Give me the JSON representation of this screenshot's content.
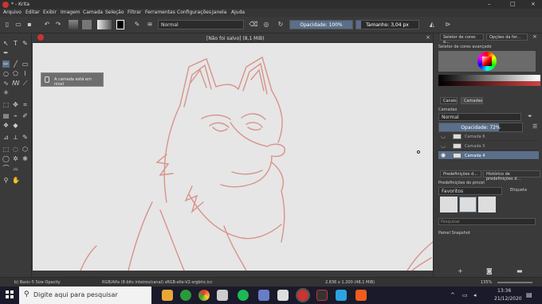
{
  "window": {
    "title": "* - Krita",
    "controls": [
      "–",
      "□",
      "×"
    ]
  },
  "menu": [
    "Arquivo",
    "Editar",
    "Exibir",
    "Imagem",
    "Camada",
    "Seleção",
    "Filtrar",
    "Ferramentas",
    "Configurações",
    "Janela",
    "Ajuda"
  ],
  "toolbar": {
    "blend_mode": "Normal",
    "opacity_label": "Opacidade: 100%",
    "opacity_value": 1.0,
    "size_label": "Tamanho: 3,04 px",
    "size_value": 0.08
  },
  "canvas": {
    "doc_title": "[Não foi salvo]  (8,1 MiB)",
    "tooltip": "A camada está em nível"
  },
  "docker": {
    "tabs": [
      "Seletor de cores a...",
      "Opções da fer..."
    ],
    "color_selector_title": "Seletor de cores avançado",
    "panel_tabs": [
      "Canais",
      "Camadas"
    ],
    "layers_title": "Camadas",
    "layer_blend": "Normal",
    "layer_opacity_label": "Opacidade:  72%",
    "layer_opacity_value": 0.72,
    "layers": [
      {
        "name": "Camada 6",
        "selected": false
      },
      {
        "name": "Camada 5",
        "selected": false
      },
      {
        "name": "Camada 4",
        "selected": true
      }
    ],
    "sub_tabs": [
      "Predefinições d...",
      "Histórico de predefinições d..."
    ],
    "brush_title": "Predefinições do pincel",
    "brush_group": "Favoritos",
    "brush_tag": "Etiqueta",
    "search_placeholder": "Pesquisar",
    "snapshot_label": "Painel Snapshot"
  },
  "status": {
    "brush": "b) Basic-5 Size Opacity",
    "colorspace": "RGB/Alfa (8-bits inteiros/canal)  sRGB-elle-V2-srgbtrc.icc",
    "dimensions": "2.836 x 1.200 (48,1 MiB)",
    "zoom": "135%"
  },
  "taskbar": {
    "search_placeholder": "Digite aqui para pesquisar",
    "time": "13:36",
    "date": "21/12/2020"
  },
  "colors": {
    "accent": "#5a6f8a",
    "stroke": "#d9928a",
    "canvas": "#e6e6e6"
  }
}
